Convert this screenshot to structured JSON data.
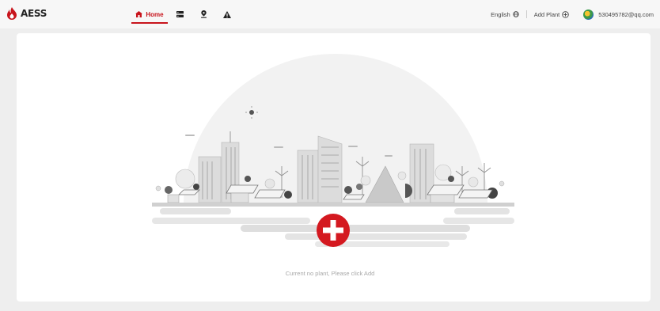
{
  "header": {
    "logo_text": "AESS",
    "nav": {
      "home_label": "Home"
    },
    "language_label": "English",
    "add_plant_label": "Add Plant",
    "user_email": "530495782@qq.com"
  },
  "main": {
    "empty_message": "Current no plant, Please click Add"
  },
  "colors": {
    "brand_red": "#c8141c",
    "illustration_gray": "#d9d9d9"
  },
  "icons": {
    "logo": "flame-logo-icon",
    "home": "home-icon",
    "list": "list-icon",
    "location": "location-pin-icon",
    "alarm": "warning-icon",
    "language": "globe-icon",
    "add": "plus-circle-icon",
    "add_big": "add-plant-big-icon"
  }
}
